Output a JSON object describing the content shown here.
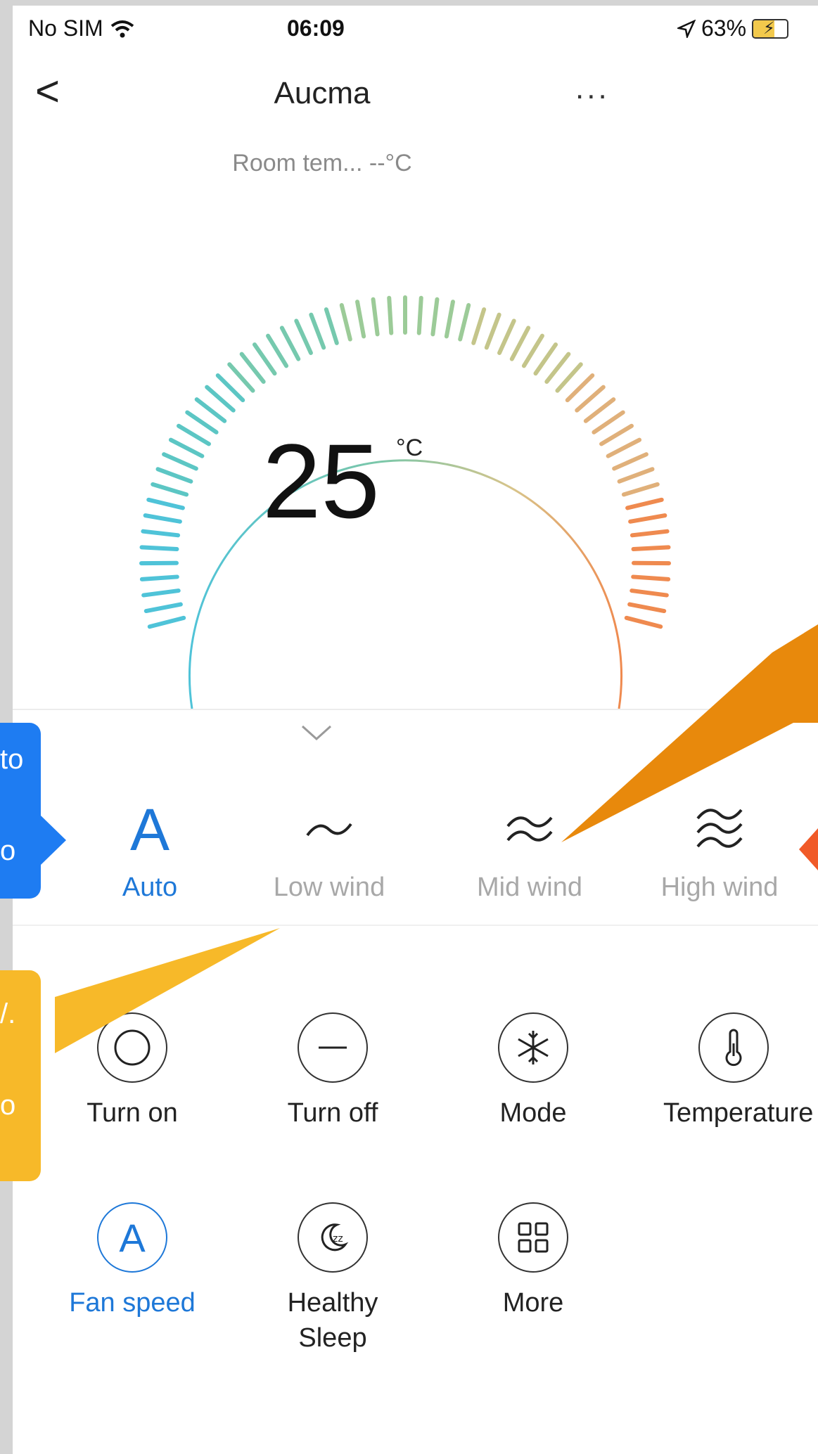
{
  "status_bar": {
    "carrier": "No SIM",
    "time": "06:09",
    "battery": "63%"
  },
  "nav": {
    "back": "<",
    "title": "Aucma",
    "more": "..."
  },
  "room_temp": "Room tem... --°C",
  "temperature": {
    "value": "25",
    "unit": "°C"
  },
  "fan_speed_options": [
    {
      "icon": "auto-letter-icon",
      "letter": "A",
      "label": "Auto",
      "selected": true
    },
    {
      "icon": "low-wind-icon",
      "label": "Low wind",
      "selected": false
    },
    {
      "icon": "mid-wind-icon",
      "label": "Mid wind",
      "selected": false
    },
    {
      "icon": "high-wind-icon",
      "label": "High wind",
      "selected": false
    }
  ],
  "controls": [
    {
      "icon": "power-on-icon",
      "label": "Turn on"
    },
    {
      "icon": "power-off-icon",
      "label": "Turn off"
    },
    {
      "icon": "snowflake-icon",
      "label": "Mode"
    },
    {
      "icon": "thermometer-icon",
      "label": "Temperature"
    },
    {
      "icon": "fan-speed-icon",
      "letter": "A",
      "label": "Fan speed",
      "active": true
    },
    {
      "icon": "sleep-icon",
      "label": "Healthy Sleep"
    },
    {
      "icon": "grid-icon",
      "label": "More"
    }
  ],
  "callouts": {
    "blue": {
      "line1": "to",
      "line2": "o"
    },
    "yellow": {
      "line1": "/.",
      "line2": "o"
    }
  },
  "colors": {
    "accent": "#1e78d8",
    "callout_blue": "#1e7cf2",
    "callout_yellow": "#f7b929",
    "callout_orange": "#e8890c",
    "callout_red": "#f05a28"
  }
}
